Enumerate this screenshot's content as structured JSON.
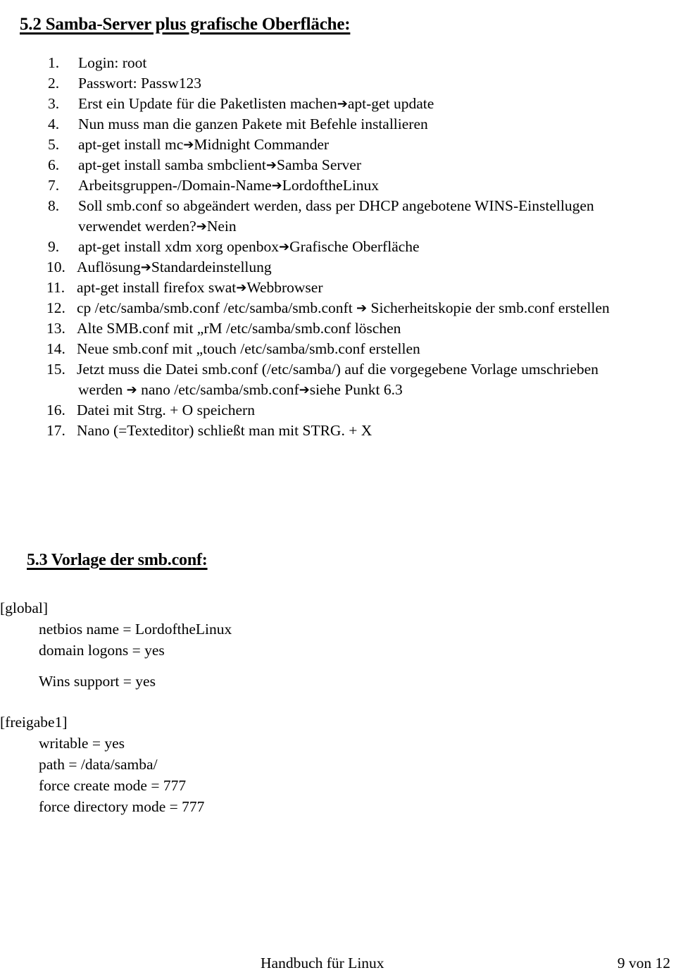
{
  "document": {
    "title": "Handbuch für Linux",
    "page_label": "9 von 12"
  },
  "section_52": {
    "heading": "5.2 Samba-Server plus grafische Oberfläche:",
    "steps": [
      {
        "num": "1.",
        "text": "Login: root"
      },
      {
        "num": "2.",
        "text": "Passwort: Passw123"
      },
      {
        "num": "3.",
        "text": "Erst ein Update für die Paketlisten machen➔apt-get update"
      },
      {
        "num": "4.",
        "text": "Nun muss man die ganzen Pakete mit Befehle installieren"
      },
      {
        "num": "5.",
        "text": "apt-get install mc➔Midnight Commander"
      },
      {
        "num": "6.",
        "text": "apt-get install samba smbclient➔Samba Server"
      },
      {
        "num": "7.",
        "text": "Arbeitsgruppen-/Domain-Name➔LordoftheLinux"
      },
      {
        "num": "8.",
        "text": "Soll smb.conf so abgeändert werden, dass per DHCP angebotene WINS-Einstellugen",
        "cont": "verwendet werden?➔Nein"
      },
      {
        "num": "9.",
        "text": "apt-get install xdm xorg openbox➔Grafische Oberfläche"
      },
      {
        "num": "10.",
        "text": "Auflösung➔Standardeinstellung"
      },
      {
        "num": "11.",
        "text": "apt-get install firefox swat➔Webbrowser"
      },
      {
        "num": "12.",
        "text": "cp /etc/samba/smb.conf /etc/samba/smb.conft ➔ Sicherheitskopie der smb.conf erstellen"
      },
      {
        "num": "13.",
        "text": "Alte SMB.conf mit „rM /etc/samba/smb.conf löschen"
      },
      {
        "num": "14.",
        "text": "Neue smb.conf mit „touch /etc/samba/smb.conf erstellen"
      },
      {
        "num": "15.",
        "text": "Jetzt muss die Datei smb.conf (/etc/samba/) auf die vorgegebene Vorlage umschrieben",
        "cont": "werden ➔ nano /etc/samba/smb.conf➔siehe Punkt 6.3"
      },
      {
        "num": "16.",
        "text": "Datei mit Strg. + O speichern"
      },
      {
        "num": "17.",
        "text": "Nano (=Texteditor)  schließt man mit STRG. + X"
      }
    ]
  },
  "section_53": {
    "heading": "5.3 Vorlage der smb.conf:",
    "conf": {
      "global_header": "[global]",
      "global_entries": [
        "netbios name = LordoftheLinux",
        "domain logons = yes"
      ],
      "global_entries_second": [
        "Wins support = yes"
      ],
      "share_header": "[freigabe1]",
      "share_entries": [
        "writable = yes",
        "path = /data/samba/",
        "force create mode = 777",
        "force directory mode = 777"
      ]
    }
  }
}
